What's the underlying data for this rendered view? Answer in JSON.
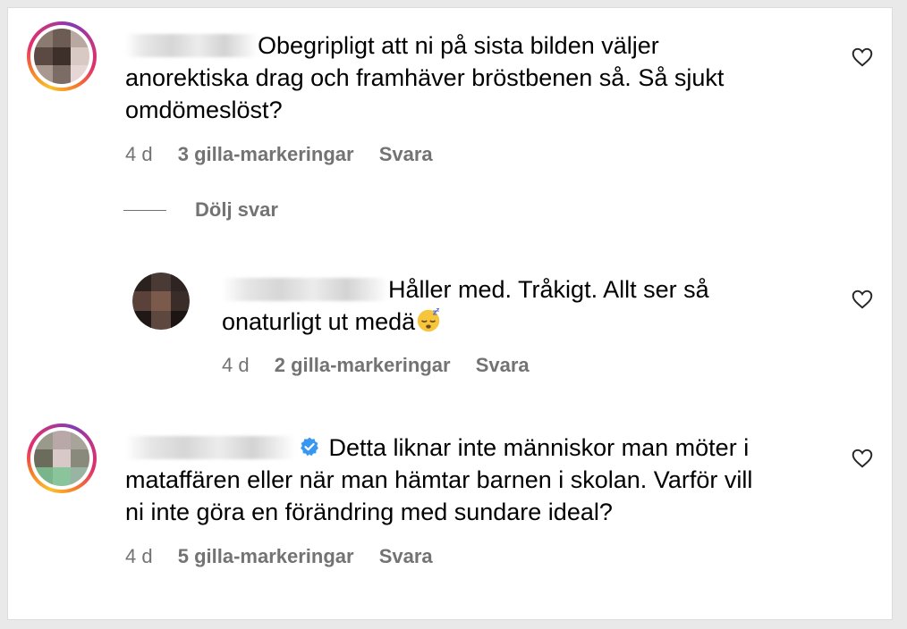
{
  "comments": [
    {
      "text_lines": [
        "Obegripligt att ni på sista bilden väljer",
        "anorektiska drag och framhäver bröstbenen så. Så sjukt",
        "omdömeslöst?"
      ],
      "time": "4 d",
      "likes": "3 gilla-markeringar",
      "reply": "Svara"
    },
    {
      "text_lines": [
        "Håller med. Tråkigt. Allt ser så",
        "onaturligt ut medä"
      ],
      "emoji": "sleeping-face-icon",
      "time": "4 d",
      "likes": "2 gilla-markeringar",
      "reply": "Svara"
    },
    {
      "text_lines": [
        "Detta liknar inte människor man möter i",
        "mataffären eller när man hämtar barnen i skolan. Varför vill",
        "ni inte göra en förändring med sundare ideal?"
      ],
      "verified": true,
      "time": "4 d",
      "likes": "5 gilla-markeringar",
      "reply": "Svara"
    }
  ],
  "replies_toggle": "Dölj svar",
  "colors": {
    "meta_text": "#737373",
    "verified_blue": "#3897f0"
  },
  "icons": {
    "like": "heart-outline-icon",
    "verified": "verified-badge-icon"
  }
}
